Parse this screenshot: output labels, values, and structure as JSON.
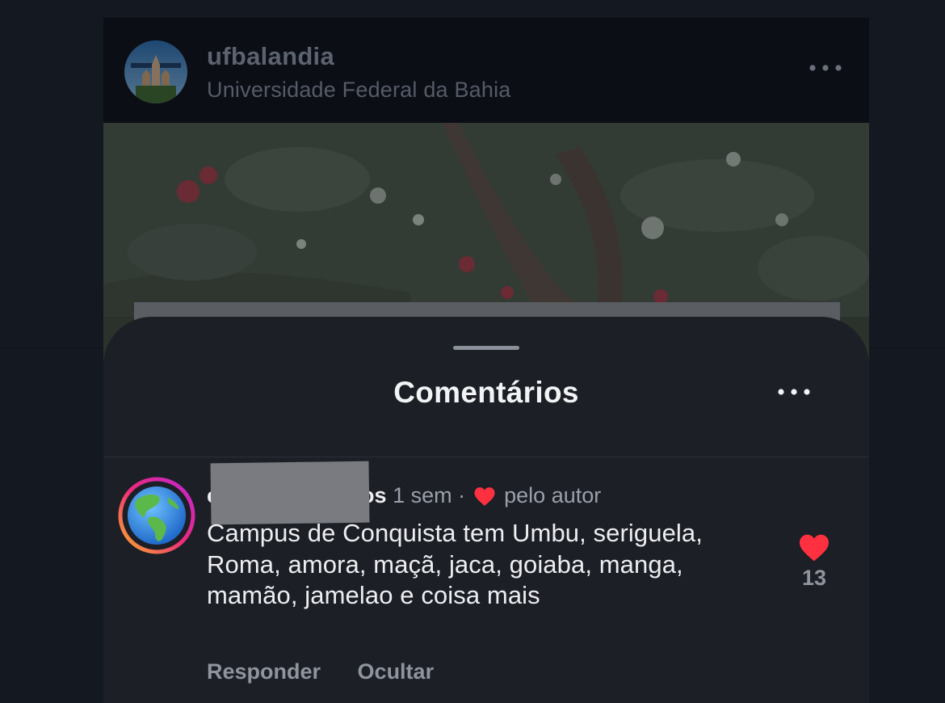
{
  "post": {
    "username": "ufbalandia",
    "location": "Universidade Federal da Bahia",
    "more_icon": "ellipsis-icon"
  },
  "comments_sheet": {
    "title": "Comentários",
    "more_icon": "ellipsis-icon",
    "comment": {
      "username_visible_start": "c",
      "username_visible_end": "os",
      "time": "1 sem",
      "separator": "·",
      "liked_by_author_label": "pelo autor",
      "text": "Campus de Conquista tem Umbu, seriguela, Roma, amora, maçã, jaca, goiaba, manga, mamão, jamelao e coisa mais",
      "reply_label": "Responder",
      "hide_label": "Ocultar",
      "like_count": "13",
      "avatar_icon": "globe-americas-icon"
    }
  },
  "colors": {
    "heart": "#ff3040",
    "sheet_background": "#1c1f26",
    "page_background": "#141821"
  }
}
